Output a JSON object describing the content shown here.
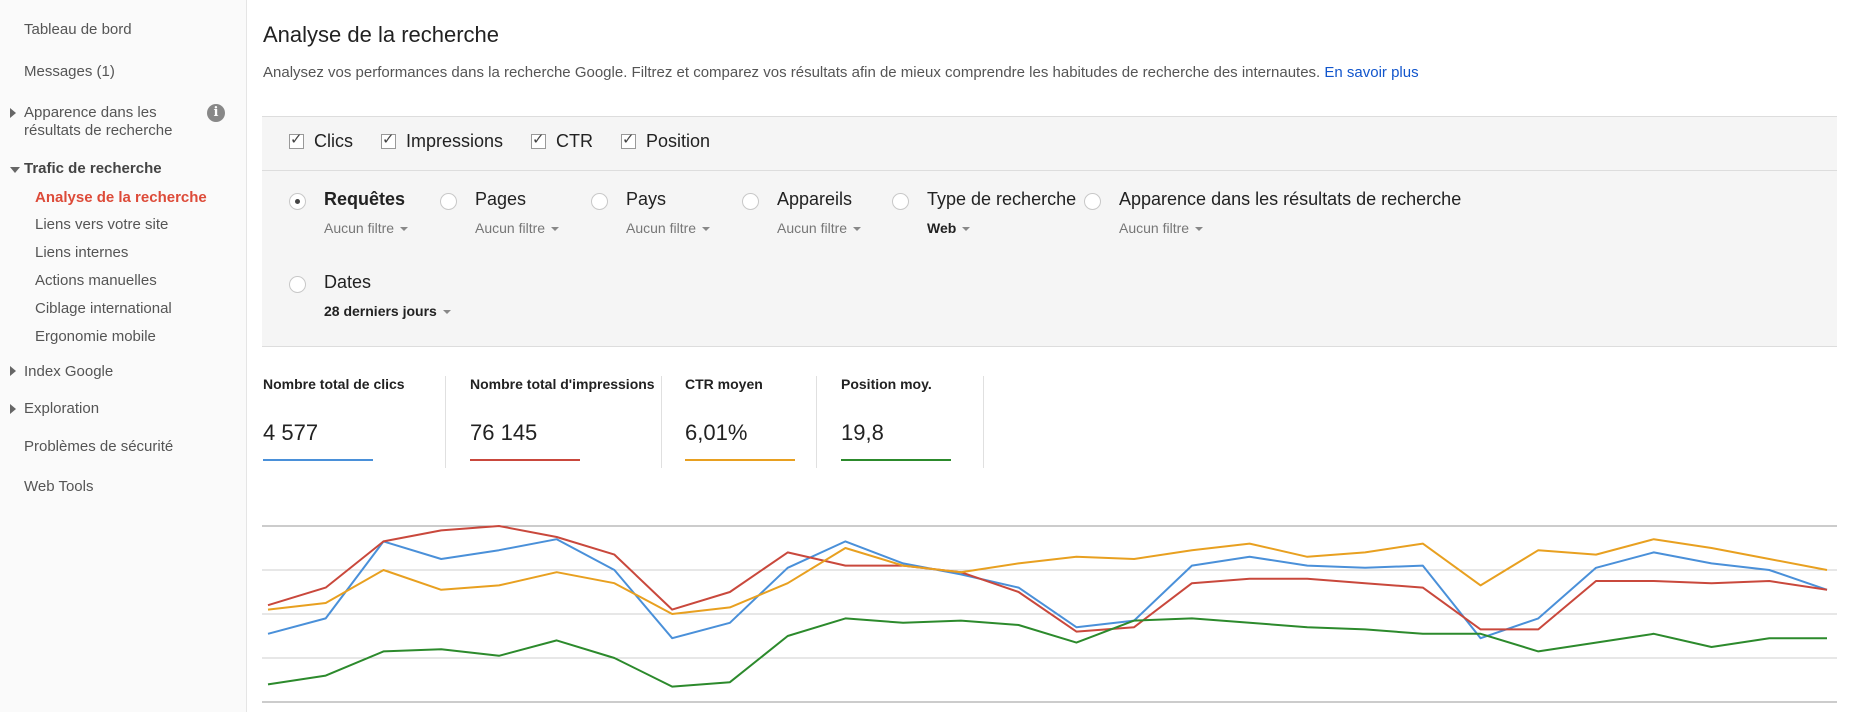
{
  "sidebar": {
    "items": {
      "dashboard": "Tableau de bord",
      "messages": "Messages (1)",
      "appearance_line1": "Apparence dans les",
      "appearance_line2": "résultats de recherche",
      "search_traffic": "Trafic de recherche",
      "search_analytics": "Analyse de la recherche",
      "links_to_site": "Liens vers votre site",
      "internal_links": "Liens internes",
      "manual_actions": "Actions manuelles",
      "intl_targeting": "Ciblage international",
      "mobile_usability": "Ergonomie mobile",
      "google_index": "Index Google",
      "crawl": "Exploration",
      "security": "Problèmes de sécurité",
      "web_tools": "Web Tools"
    },
    "info_glyph": "i"
  },
  "main": {
    "title": "Analyse de la recherche",
    "description": "Analysez vos performances dans la recherche Google. Filtrez et comparez vos résultats afin de mieux comprendre les habitudes de recherche des internautes.",
    "learn_more": "En savoir plus"
  },
  "metrics_toggles": {
    "clicks": "Clics",
    "impressions": "Impressions",
    "ctr": "CTR",
    "position": "Position"
  },
  "groupings": {
    "queries": {
      "label": "Requêtes",
      "filter": "Aucun filtre",
      "selected": true
    },
    "pages": {
      "label": "Pages",
      "filter": "Aucun filtre"
    },
    "countries": {
      "label": "Pays",
      "filter": "Aucun filtre"
    },
    "devices": {
      "label": "Appareils",
      "filter": "Aucun filtre"
    },
    "search_type": {
      "label": "Type de recherche",
      "filter": "Web"
    },
    "search_appearance": {
      "label": "Apparence dans les résultats de recherche",
      "filter": "Aucun filtre"
    },
    "dates": {
      "label": "Dates",
      "filter": "28 derniers jours"
    }
  },
  "totals": {
    "clicks": {
      "label": "Nombre total de clics",
      "value": "4 577",
      "color": "#4a90d9"
    },
    "impressions": {
      "label": "Nombre total d'impressions",
      "value": "76 145",
      "color": "#c9483c"
    },
    "ctr": {
      "label": "CTR moyen",
      "value": "6,01%",
      "color": "#e8a020"
    },
    "position": {
      "label": "Position moy.",
      "value": "19,8",
      "color": "#2c8a2c"
    }
  },
  "chart_data": {
    "type": "line",
    "x": [
      1,
      2,
      3,
      4,
      5,
      6,
      7,
      8,
      9,
      10,
      11,
      12,
      13,
      14,
      15,
      16,
      17,
      18,
      19,
      20,
      21,
      22,
      23,
      24,
      25,
      26,
      27,
      28
    ],
    "ylim": [
      0,
      4
    ],
    "grid": true,
    "series": [
      {
        "name": "Clics",
        "color": "#4a90d9",
        "values": [
          1.55,
          1.9,
          3.65,
          3.25,
          3.45,
          3.7,
          3.0,
          1.45,
          1.8,
          3.05,
          3.65,
          3.15,
          2.9,
          2.6,
          1.7,
          1.85,
          3.1,
          3.3,
          3.1,
          3.05,
          3.1,
          1.45,
          1.9,
          3.05,
          3.4,
          3.15,
          3.0,
          2.55
        ]
      },
      {
        "name": "Impressions",
        "color": "#c9483c",
        "values": [
          2.2,
          2.6,
          3.65,
          3.9,
          4.0,
          3.75,
          3.35,
          2.1,
          2.5,
          3.4,
          3.1,
          3.1,
          2.95,
          2.5,
          1.6,
          1.7,
          2.7,
          2.8,
          2.8,
          2.7,
          2.6,
          1.65,
          1.65,
          2.75,
          2.75,
          2.7,
          2.75,
          2.55
        ]
      },
      {
        "name": "CTR",
        "color": "#e8a020",
        "values": [
          2.1,
          2.25,
          3.0,
          2.55,
          2.65,
          2.95,
          2.7,
          2.0,
          2.15,
          2.7,
          3.5,
          3.1,
          2.95,
          3.15,
          3.3,
          3.25,
          3.45,
          3.6,
          3.3,
          3.4,
          3.6,
          2.65,
          3.45,
          3.35,
          3.7,
          3.5,
          3.25,
          3.0
        ]
      },
      {
        "name": "Position",
        "color": "#2c8a2c",
        "values": [
          0.4,
          0.6,
          1.15,
          1.2,
          1.05,
          1.4,
          1.0,
          0.35,
          0.45,
          1.5,
          1.9,
          1.8,
          1.85,
          1.75,
          1.35,
          1.85,
          1.9,
          1.8,
          1.7,
          1.65,
          1.55,
          1.55,
          1.15,
          1.35,
          1.55,
          1.25,
          1.45,
          1.45
        ]
      }
    ]
  }
}
